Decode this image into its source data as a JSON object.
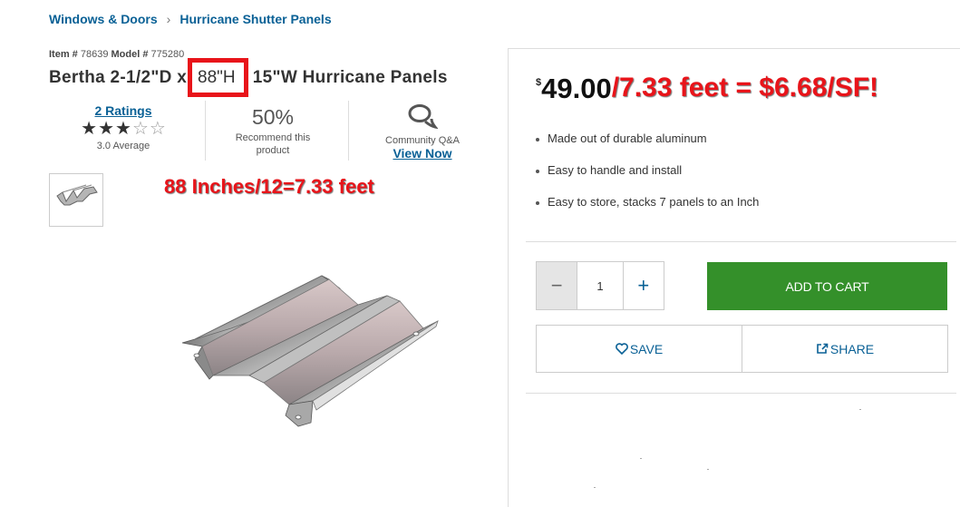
{
  "breadcrumb": {
    "items": [
      "Windows & Doors",
      "Hurricane Shutter Panels"
    ]
  },
  "product": {
    "item_label": "Item #",
    "item_number": "78639",
    "model_label": "Model #",
    "model_number": "775280",
    "title": "Bertha 2-1/2\"D x 88\"H x 15\"W Hurricane Panels",
    "highlight": "88\"H"
  },
  "ratings": {
    "count": "2 Ratings",
    "stars": 3,
    "max_stars": 5,
    "average": "3.0 Average"
  },
  "recommend": {
    "percent": "50%",
    "label_line1": "Recommend this",
    "label_line2": "product"
  },
  "qa": {
    "icon": "chat-bubbles-icon",
    "label": "Community Q&A",
    "link": "View Now"
  },
  "annotations": {
    "inches": "88 Inches/12=7.33 feet",
    "price_calc": "/7.33 feet = $6.68/SF!"
  },
  "price": {
    "currency": "$",
    "amount": "49.00"
  },
  "features": [
    "Made out of durable aluminum",
    "Easy to handle and install",
    "Easy to store, stacks 7 panels to an Inch"
  ],
  "quantity": {
    "value": "1",
    "minus": "−",
    "plus": "+"
  },
  "actions": {
    "add_to_cart": "ADD TO CART",
    "save": "SAVE",
    "share": "SHARE"
  },
  "colors": {
    "link_blue": "#0a6196",
    "cart_green": "#34902a",
    "annotation_red": "#e8141a"
  }
}
